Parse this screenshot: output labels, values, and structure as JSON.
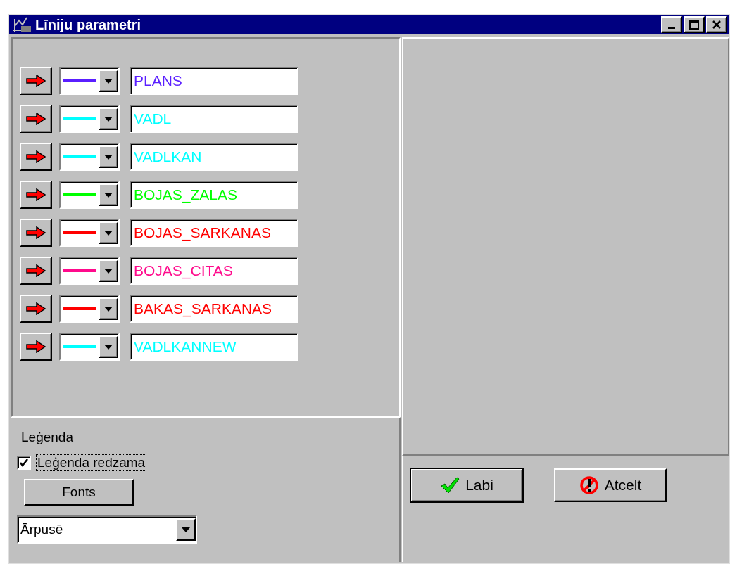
{
  "window": {
    "title": "Līniju parametri"
  },
  "lines": [
    {
      "name": "PLANS",
      "color": "#5a1fff"
    },
    {
      "name": "VADL",
      "color": "#00ffff"
    },
    {
      "name": "VADLKAN",
      "color": "#00ffff"
    },
    {
      "name": "BOJAS_ZALAS",
      "color": "#00ff00"
    },
    {
      "name": "BOJAS_SARKANAS",
      "color": "#ff0000"
    },
    {
      "name": "BOJAS_CITAS",
      "color": "#ff0a8c"
    },
    {
      "name": "BAKAS_SARKANAS",
      "color": "#ff0000"
    },
    {
      "name": "VADLKANNEW",
      "color": "#00ffff"
    }
  ],
  "legend": {
    "label": "Leģenda",
    "checkbox": {
      "label": "Leģenda redzama",
      "checked": true,
      "focused": true
    },
    "fonts_button": "Fonts",
    "position": {
      "value": "Ārpusē"
    }
  },
  "buttons": [
    {
      "label": "Labi",
      "kind": "ok",
      "default": true
    },
    {
      "label": "Atcelt",
      "kind": "cancel",
      "default": false
    }
  ]
}
